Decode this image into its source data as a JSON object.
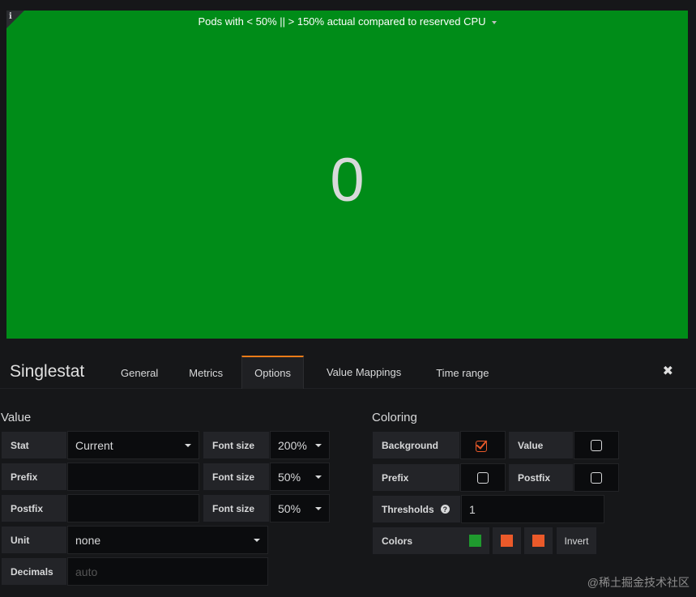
{
  "panel": {
    "info_glyph": "i",
    "title": "Pods with < 50% || > 150% actual compared to reserved CPU",
    "value": "0",
    "background_color": "#008c18"
  },
  "editor": {
    "title": "Singlestat",
    "tabs": [
      "General",
      "Metrics",
      "Options",
      "Value Mappings",
      "Time range"
    ],
    "active_tab": "Options",
    "close_glyph": "✖"
  },
  "value_section": {
    "title": "Value",
    "stat_label": "Stat",
    "stat_value": "Current",
    "prefix_label": "Prefix",
    "prefix_value": "",
    "postfix_label": "Postfix",
    "postfix_value": "",
    "unit_label": "Unit",
    "unit_value": "none",
    "decimals_label": "Decimals",
    "decimals_placeholder": "auto",
    "font_size_label": "Font size",
    "value_font_size": "200%",
    "prefix_font_size": "50%",
    "postfix_font_size": "50%"
  },
  "coloring_section": {
    "title": "Coloring",
    "background_label": "Background",
    "background_checked": true,
    "value_label": "Value",
    "value_checked": false,
    "prefix_label": "Prefix",
    "prefix_checked": false,
    "postfix_label": "Postfix",
    "postfix_checked": false,
    "thresholds_label": "Thresholds",
    "thresholds_help_glyph": "?",
    "thresholds_value": "1",
    "colors_label": "Colors",
    "colors": [
      "#1f9a2e",
      "#eb5a2a",
      "#eb5a2a"
    ],
    "invert_label": "Invert"
  },
  "watermark": "@稀土掘金技术社区"
}
